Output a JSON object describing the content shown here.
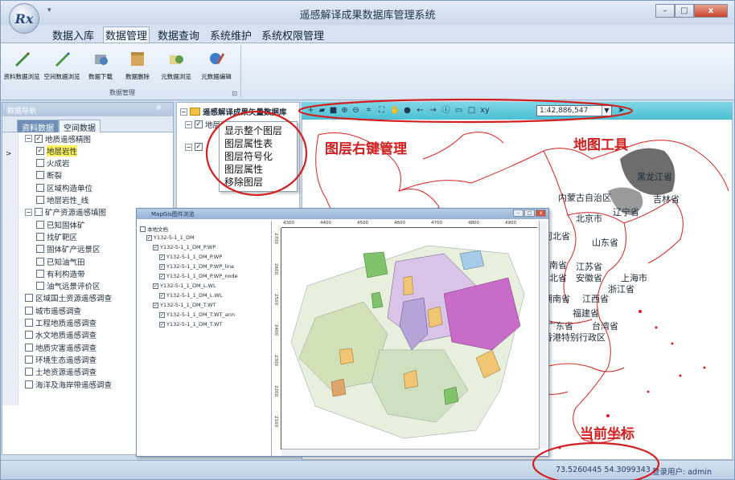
{
  "window": {
    "title": "遥感解译成果数据库管理系统",
    "app_logo": "Rx",
    "minimize": "–",
    "maximize": "□",
    "close": "x"
  },
  "menu": {
    "tabs": [
      "数据入库",
      "数据管理",
      "数据查询",
      "系统维护",
      "系统权限管理"
    ],
    "active": "数据管理"
  },
  "ribbon": {
    "buttons": [
      "资料数据浏览",
      "空间数据浏览",
      "数据下载",
      "数据删除",
      "元数据浏览",
      "元数据编辑"
    ],
    "group_label": "数据管理"
  },
  "left_panel": {
    "header": "数据导航",
    "pin": "#",
    "tabs": [
      "资料数据",
      "空间数据"
    ],
    "active_tab": "资料数据",
    "tree": [
      {
        "label": "地质遥感精图",
        "level": 1,
        "expander": "−",
        "checked": true
      },
      {
        "label": "地层岩性",
        "level": 2,
        "checked": true,
        "highlighted": true
      },
      {
        "label": "火成岩",
        "level": 2,
        "checked": false
      },
      {
        "label": "断裂",
        "level": 2,
        "checked": false
      },
      {
        "label": "区域构造单位",
        "level": 2,
        "checked": false
      },
      {
        "label": "地层岩性_线",
        "level": 2,
        "checked": false
      },
      {
        "label": "矿产资源遥感填图",
        "level": 1,
        "expander": "−",
        "checked": false
      },
      {
        "label": "已知固体矿",
        "level": 2,
        "checked": false
      },
      {
        "label": "找矿靶区",
        "level": 2,
        "checked": false
      },
      {
        "label": "固体矿产远景区",
        "level": 2,
        "checked": false
      },
      {
        "label": "已知油气田",
        "level": 2,
        "checked": false
      },
      {
        "label": "有利构造带",
        "level": 2,
        "checked": false
      },
      {
        "label": "油气远景评价区",
        "level": 2,
        "checked": false
      },
      {
        "label": "区域国土资源遥感调查",
        "level": 1,
        "checked": false
      },
      {
        "label": "城市遥感调查",
        "level": 1,
        "checked": false
      },
      {
        "label": "工程地质遥感调查",
        "level": 1,
        "checked": false
      },
      {
        "label": "水文地质遥感调查",
        "level": 1,
        "checked": false
      },
      {
        "label": "地质灾害遥感调查",
        "level": 1,
        "checked": false
      },
      {
        "label": "环境生态遥感调查",
        "level": 1,
        "checked": false
      },
      {
        "label": "土地资源遥感调查",
        "level": 1,
        "checked": false
      },
      {
        "label": "海洋及海岸带遥感调查",
        "level": 1,
        "checked": false
      }
    ]
  },
  "layer_panel": {
    "root": "遥感解译成果矢量数据库",
    "child": "地层岩性"
  },
  "context_menu": {
    "items": [
      "显示整个图层",
      "图层属性表",
      "图层符号化",
      "图层属性",
      "移除图层"
    ]
  },
  "map": {
    "scale": "1:42,886,547",
    "scale_dropdown": "▼",
    "annotations": {
      "layer_menu": "图层右键管理",
      "map_tools": "地图工具",
      "current_coord": "当前坐标"
    },
    "labels": [
      "黑龙江省",
      "内蒙古自治区",
      "吉林省",
      "北京市",
      "辽宁省",
      "河北省",
      "山东省",
      "河南省",
      "江苏省",
      "湖北省",
      "安徽省",
      "上海市",
      "浙江省",
      "湖南省",
      "江西省",
      "福建省",
      "广东省",
      "台湾省",
      "香港特别行政区"
    ]
  },
  "sub_window": {
    "title": "MapGis图件浏览",
    "tree": [
      "本地文档",
      "Y132-5-1_1_DM",
      "Y132-5-1_1_DM_P.WP",
      "Y132-5-1_1_DM_P.WP",
      "Y132-5-1_1_DM_P.WP_line",
      "Y132-5-1_1_DM_P.WP_node",
      "Y132-5-1_1_DM_L.WL",
      "Y132-5-1_1_DM_L.WL",
      "Y132-5-1_1_DM_T.WT",
      "Y132-5-1_1_DM_T.WT_ann",
      "Y132-5-1_1_DM_T.WT"
    ],
    "ruler_top": [
      "4300",
      "4400",
      "4500",
      "4600",
      "4700",
      "4800",
      "4900"
    ],
    "ruler_left": [
      "2700",
      "2600",
      "2500",
      "2400",
      "2300",
      "2200",
      "2100"
    ]
  },
  "status": {
    "coords": "73.5260445  54.3099343",
    "user": "登录用户: admin"
  },
  "colors": {
    "toolbar_cyan": "#57c5d8",
    "annotation_red": "#d21f1f",
    "highlight_yellow": "#fff15c"
  }
}
